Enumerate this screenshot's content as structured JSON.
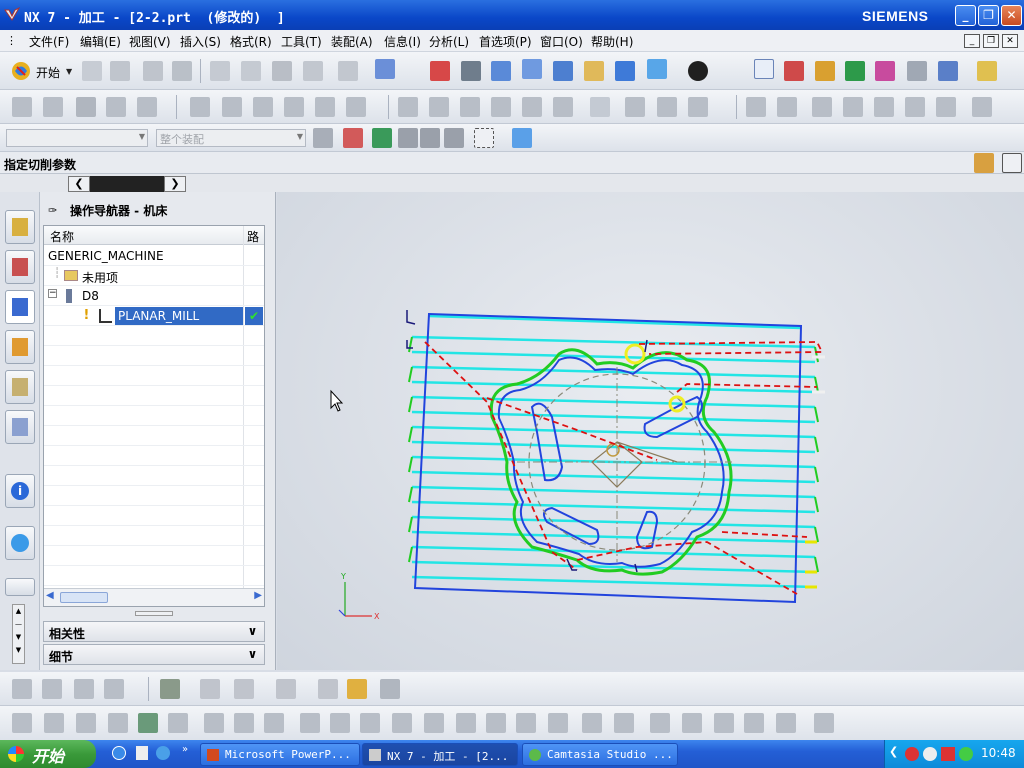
{
  "window": {
    "title": "NX 7 - 加工 - [2-2.prt  (修改的)  ]",
    "brand": "SIEMENS",
    "controls": [
      "_",
      "❐",
      "✕"
    ]
  },
  "menu": {
    "items": [
      "文件(F)",
      "编辑(E)",
      "视图(V)",
      "插入(S)",
      "格式(R)",
      "工具(T)",
      "装配(A)",
      "信息(I)",
      "分析(L)",
      "首选项(P)",
      "窗口(O)",
      "帮助(H)"
    ]
  },
  "toolbar": {
    "start_label": "开始",
    "filter_placeholder": "整个装配"
  },
  "cue": {
    "text": "指定切削参数"
  },
  "navigator": {
    "title": "操作导航器 - 机床",
    "columns": [
      "名称",
      "路"
    ],
    "items": [
      "GENERIC_MACHINE",
      "未用项",
      "D8",
      "PLANAR_MILL"
    ],
    "sections": [
      "相关性",
      "细节"
    ]
  },
  "taskbar": {
    "start": "开始",
    "tasks": [
      "Microsoft PowerP...",
      "NX 7 - 加工 - [2...",
      "Camtasia Studio ..."
    ],
    "clock": "10:48"
  },
  "colors": {
    "toolpath_cyan": "#22e5e5",
    "part_blue": "#2244dd",
    "boundary_green": "#22cc22",
    "rapid_red": "#dd1111",
    "title_blue": "#0a47c8"
  }
}
